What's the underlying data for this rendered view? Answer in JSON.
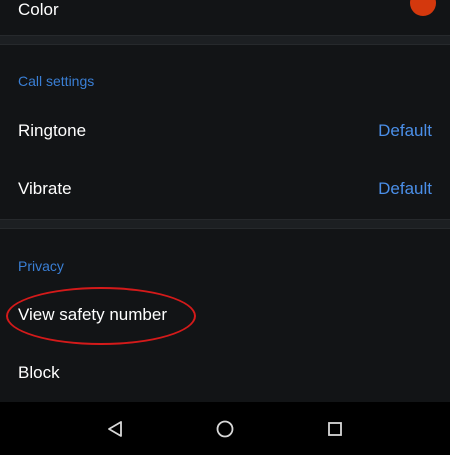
{
  "settings": {
    "color_label": "Color",
    "color_value": "#d4380d",
    "call_settings_header": "Call settings",
    "ringtone_label": "Ringtone",
    "ringtone_value": "Default",
    "vibrate_label": "Vibrate",
    "vibrate_value": "Default",
    "privacy_header": "Privacy",
    "safety_number_label": "View safety number",
    "block_label": "Block"
  },
  "navbar": {
    "back_icon": "back-triangle-icon",
    "home_icon": "home-circle-icon",
    "recents_icon": "recents-square-icon"
  },
  "colors": {
    "accent": "#4b8fe8",
    "section_header": "#3a7fd5",
    "annotation": "#d41a1a",
    "background": "#121416"
  }
}
